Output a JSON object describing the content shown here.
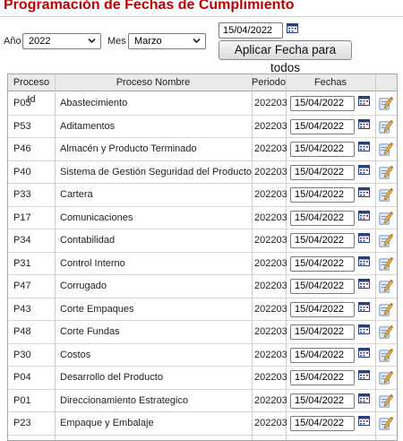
{
  "page": {
    "title": "Programación de Fechas de Cumplimiento"
  },
  "filters": {
    "year_label": "Año",
    "year_value": "2022",
    "month_label": "Mes",
    "month_value": "Marzo",
    "date_value": "15/04/2022",
    "apply_button": "Aplicar Fecha para todos"
  },
  "table": {
    "headers": [
      "Proceso Id",
      "Proceso Nombre",
      "Periodo",
      "Fechas",
      ""
    ],
    "rows": [
      {
        "id": "P05",
        "name": "Abastecimiento",
        "period": "202203",
        "date": "15/04/2022"
      },
      {
        "id": "P53",
        "name": "Aditamentos",
        "period": "202203",
        "date": "15/04/2022"
      },
      {
        "id": "P46",
        "name": "Almacén y Producto Terminado",
        "period": "202203",
        "date": "15/04/2022"
      },
      {
        "id": "P40",
        "name": "Sistema de Gestión Seguridad del Producto",
        "period": "202203",
        "date": "15/04/2022"
      },
      {
        "id": "P33",
        "name": "Cartera",
        "period": "202203",
        "date": "15/04/2022"
      },
      {
        "id": "P17",
        "name": "Comunicaciones",
        "period": "202203",
        "date": "15/04/2022"
      },
      {
        "id": "P34",
        "name": "Contabilidad",
        "period": "202203",
        "date": "15/04/2022"
      },
      {
        "id": "P31",
        "name": "Control Interno",
        "period": "202203",
        "date": "15/04/2022"
      },
      {
        "id": "P47",
        "name": "Corrugado",
        "period": "202203",
        "date": "15/04/2022"
      },
      {
        "id": "P43",
        "name": "Corte Empaques",
        "period": "202203",
        "date": "15/04/2022"
      },
      {
        "id": "P48",
        "name": "Corte Fundas",
        "period": "202203",
        "date": "15/04/2022"
      },
      {
        "id": "P30",
        "name": "Costos",
        "period": "202203",
        "date": "15/04/2022"
      },
      {
        "id": "P04",
        "name": "Desarrollo del Producto",
        "period": "202203",
        "date": "15/04/2022"
      },
      {
        "id": "P01",
        "name": "Direccionamiento Estrategico",
        "period": "202203",
        "date": "15/04/2022"
      },
      {
        "id": "P23",
        "name": "Empaque y Embalaje",
        "period": "202203",
        "date": "15/04/2022"
      }
    ]
  },
  "icons": {
    "calendar": "calendar-icon",
    "edit": "edit-note-icon",
    "dropdown": "chevron-down-icon"
  },
  "colors": {
    "title": "#c00000",
    "header_bg": "#eaeaea",
    "border": "#a8a8a8"
  }
}
